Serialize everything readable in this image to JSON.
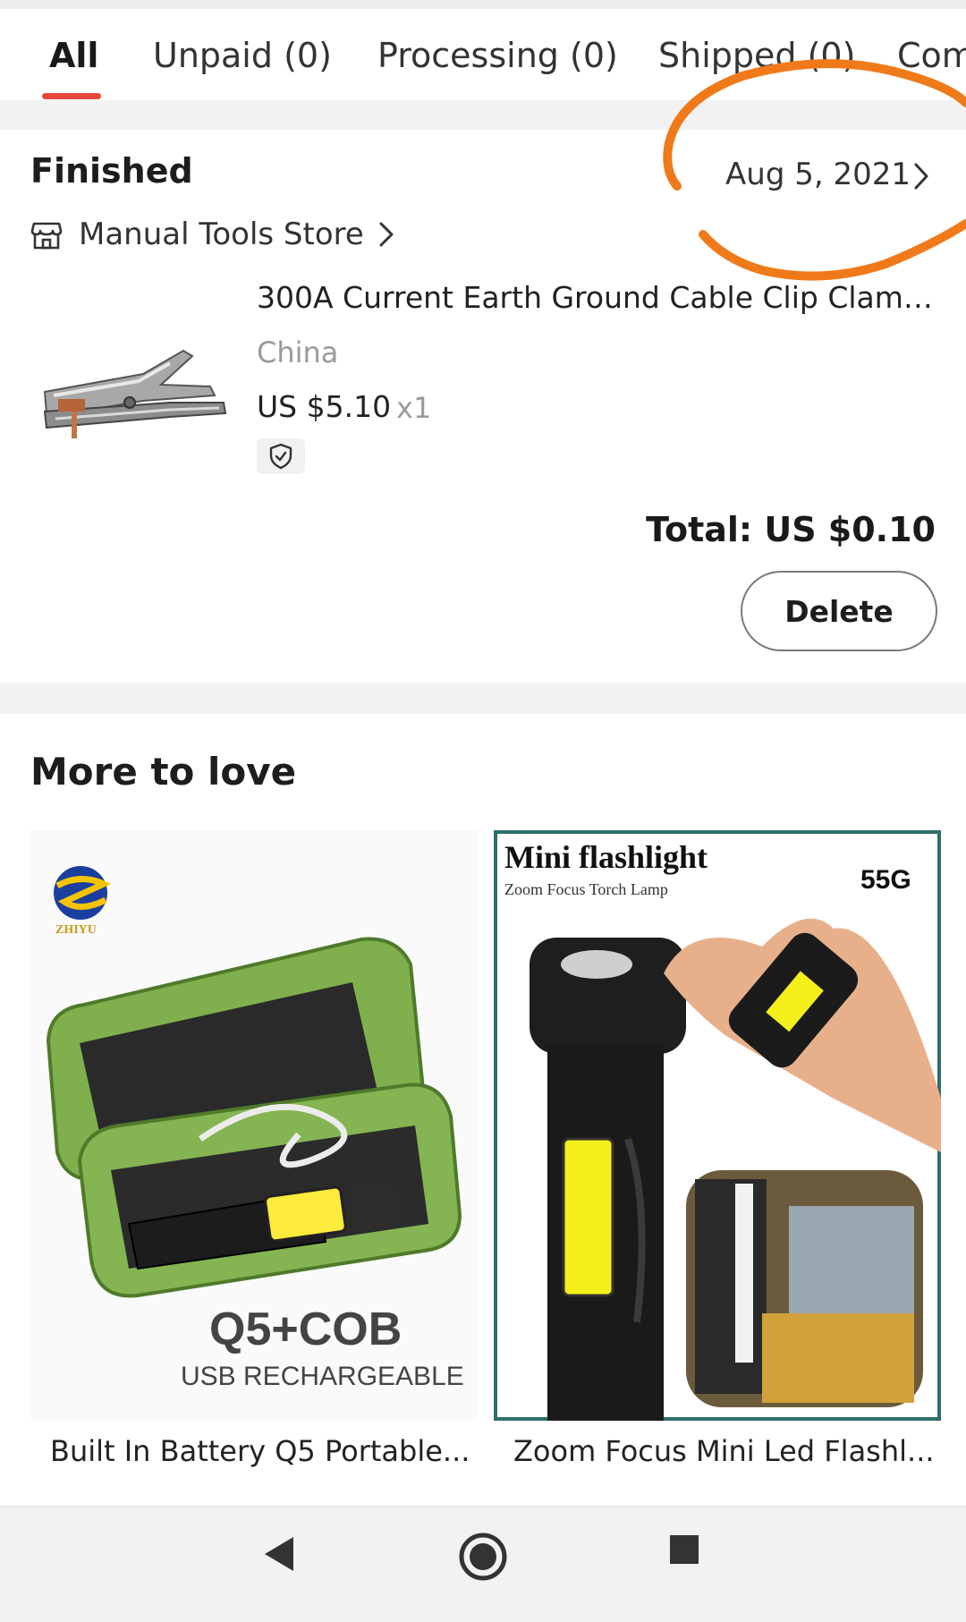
{
  "tabs": [
    {
      "label": "All"
    },
    {
      "label": "Unpaid (0)"
    },
    {
      "label": "Processing (0)"
    },
    {
      "label": "Shipped (0)"
    },
    {
      "label": "Completed"
    }
  ],
  "order": {
    "status": "Finished",
    "date": "Aug 5, 2021",
    "store": "Manual Tools Store",
    "product": {
      "title": "300A Current Earth Ground Cable Clip Clamp W...",
      "origin": "China",
      "price": "US $5.10",
      "quantity": "x1"
    },
    "total": "Total: US $0.10",
    "delete_label": "Delete"
  },
  "more_to_love": {
    "title": "More to love",
    "items": [
      {
        "caption": "Built In Battery Q5 Portable...",
        "image_text": {
          "brand": "ZHIYU",
          "line1": "Q5+COB",
          "line2": "USB RECHARGEABLE"
        }
      },
      {
        "caption": "Zoom Focus Mini Led Flashl...",
        "image_text": {
          "title": "Mini flashlight",
          "subtitle": "Zoom Focus Torch Lamp",
          "weight": "55G"
        }
      }
    ]
  },
  "colors": {
    "accent": "#e8483b",
    "annotation": "#f07a1a"
  },
  "icons": {
    "store": "store-icon",
    "shield": "shield-check-icon",
    "back": "back-triangle-icon",
    "home": "home-circle-icon",
    "recents": "recents-square-icon"
  }
}
